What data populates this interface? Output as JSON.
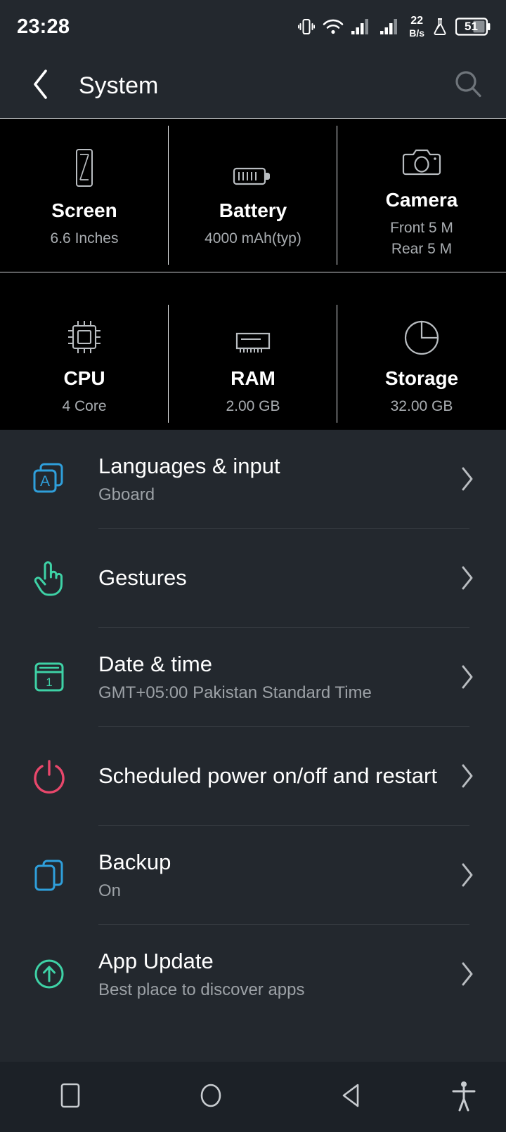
{
  "statusbar": {
    "time": "23:28",
    "netspeed_value": "22",
    "netspeed_unit": "B/s",
    "battery_percent": "51",
    "icons": [
      "vibrate-icon",
      "wifi-icon",
      "signal-sim1-icon",
      "signal-sim2-icon",
      "net-speed-indicator",
      "flask-icon",
      "battery-icon"
    ]
  },
  "appbar": {
    "title": "System",
    "back_icon": "back-chevron-icon",
    "search_icon": "search-icon"
  },
  "specs": [
    {
      "icon": "screen-icon",
      "title": "Screen",
      "sub": "6.6 Inches"
    },
    {
      "icon": "battery-icon",
      "title": "Battery",
      "sub": "4000 mAh(typ)"
    },
    {
      "icon": "camera-icon",
      "title": "Camera",
      "sub": "Front 5 M",
      "sub2": "Rear 5 M"
    },
    {
      "icon": "cpu-icon",
      "title": "CPU",
      "sub": "4 Core"
    },
    {
      "icon": "ram-icon",
      "title": "RAM",
      "sub": "2.00 GB"
    },
    {
      "icon": "storage-icon",
      "title": "Storage",
      "sub": "32.00 GB"
    }
  ],
  "list": [
    {
      "icon": "languages-icon",
      "color": "#2f9fdb",
      "title": "Languages & input",
      "sub": "Gboard"
    },
    {
      "icon": "gesture-hand-icon",
      "color": "#3ed2a6",
      "title": "Gestures",
      "sub": ""
    },
    {
      "icon": "calendar-icon",
      "color": "#3ed2a6",
      "title": "Date & time",
      "sub": "GMT+05:00 Pakistan Standard Time"
    },
    {
      "icon": "power-icon",
      "color": "#e8476b",
      "title": "Scheduled power on/off and restart",
      "sub": ""
    },
    {
      "icon": "backup-icon",
      "color": "#2f9fdb",
      "title": "Backup",
      "sub": "On"
    },
    {
      "icon": "app-update-icon",
      "color": "#3ed2a6",
      "title": "App Update",
      "sub": "Best place to discover apps"
    }
  ],
  "navbar": {
    "recents_label": "recents-square-icon",
    "home_label": "home-circle-icon",
    "back_label": "back-triangle-icon",
    "accessibility_label": "accessibility-icon"
  },
  "colors": {
    "page_bg": "#23282e",
    "card_bg": "#000000",
    "navbar_bg": "#1c2127",
    "text_primary": "#ffffff",
    "text_secondary": "#9ca1a6",
    "divider": "#33383e",
    "grid_line": "#cfd3d6"
  }
}
